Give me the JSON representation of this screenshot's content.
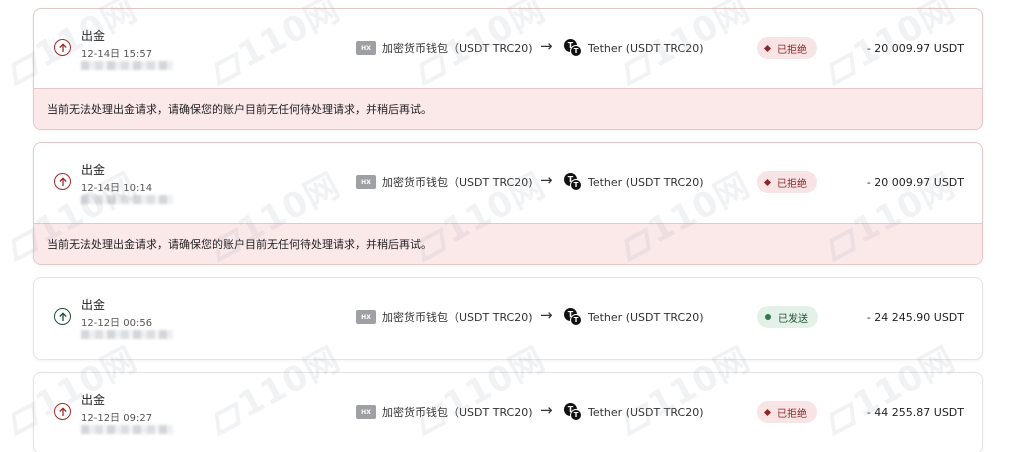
{
  "watermark_text": "110网",
  "transactions": [
    {
      "type": "出金",
      "time": "12-14日 15:57",
      "direction": "out",
      "direction_icon": "arrow-up-circle-icon",
      "source_badge": "HX",
      "source_label": "加密货币钱包（USDT TRC20)",
      "arrow": "→",
      "dest_label": "Tether (USDT TRC20)",
      "status": "已拒绝",
      "status_kind": "rejected",
      "amount": "- 20 009.97 USDT",
      "error": "当前无法处理出金请求，请确保您的账户目前无任何待处理请求，并稍后再试。"
    },
    {
      "type": "出金",
      "time": "12-14日 10:14",
      "direction": "out",
      "direction_icon": "arrow-up-circle-icon",
      "source_badge": "HX",
      "source_label": "加密货币钱包（USDT TRC20)",
      "arrow": "→",
      "dest_label": "Tether (USDT TRC20)",
      "status": "已拒绝",
      "status_kind": "rejected",
      "amount": "- 20 009.97 USDT",
      "error": "当前无法处理出金请求，请确保您的账户目前无任何待处理请求，并稍后再试。"
    },
    {
      "type": "出金",
      "time": "12-12日 00:56",
      "direction": "out",
      "direction_icon": "arrow-up-circle-icon",
      "source_badge": "HX",
      "source_label": "加密货币钱包（USDT TRC20)",
      "arrow": "→",
      "dest_label": "Tether (USDT TRC20)",
      "status": "已发送",
      "status_kind": "sent",
      "amount": "- 24 245.90 USDT"
    },
    {
      "type": "出金",
      "time": "12-12日 09:27",
      "direction": "out",
      "direction_icon": "arrow-up-circle-icon",
      "source_badge": "HX",
      "source_label": "加密货币钱包（USDT TRC20)",
      "arrow": "→",
      "dest_label": "Tether (USDT TRC20)",
      "status": "已拒绝",
      "status_kind": "rejected",
      "amount": "- 44 255.87 USDT"
    }
  ],
  "colors": {
    "rejected_text": "#8b2626",
    "rejected_bg": "#f8e4e4",
    "sent_text": "#1f5135",
    "sent_bg": "#e4f1e8",
    "error_bg": "#fbe8e9"
  }
}
